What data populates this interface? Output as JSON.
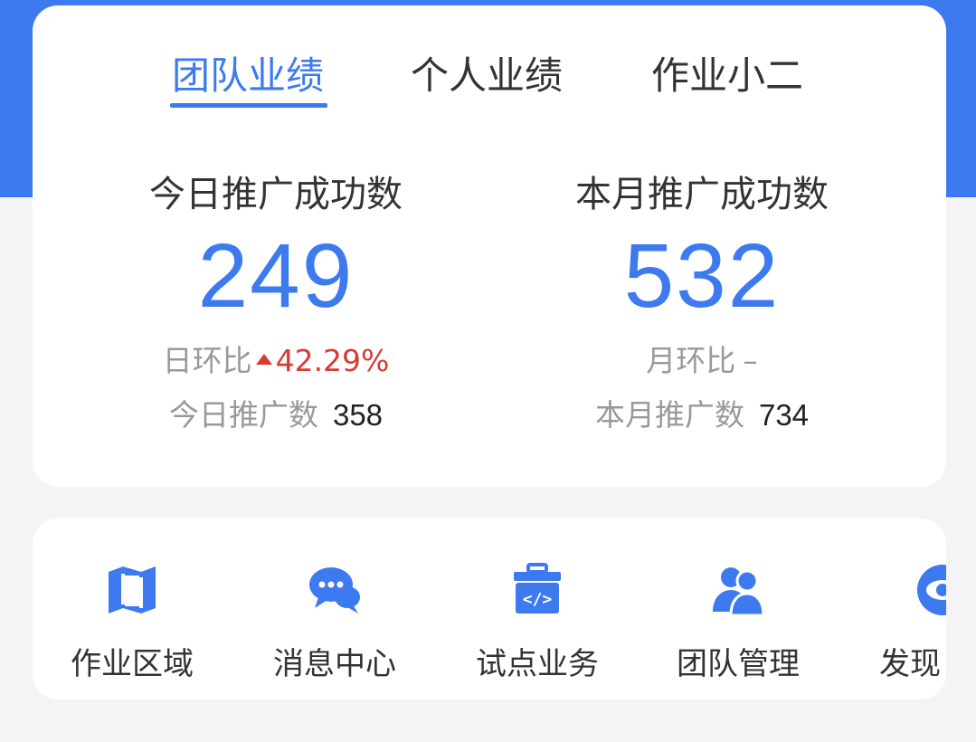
{
  "tabs": [
    {
      "label": "团队业绩",
      "active": true
    },
    {
      "label": "个人业绩",
      "active": false
    },
    {
      "label": "作业小二",
      "active": false
    }
  ],
  "today": {
    "title": "今日推广成功数",
    "value": "249",
    "ratio_label": "日环比",
    "ratio_value": "42.29%",
    "ratio_trend": "up",
    "count_label": "今日推广数",
    "count_value": "358"
  },
  "month": {
    "title": "本月推广成功数",
    "value": "532",
    "ratio_label": "月环比",
    "ratio_value": "–",
    "count_label": "本月推广数",
    "count_value": "734"
  },
  "shortcuts": [
    {
      "label": "作业区域",
      "icon": "book-icon"
    },
    {
      "label": "消息中心",
      "icon": "chat-bubble-icon"
    },
    {
      "label": "试点业务",
      "icon": "code-bag-icon"
    },
    {
      "label": "团队管理",
      "icon": "team-icon"
    },
    {
      "label": "发现",
      "icon": "eye-icon"
    }
  ],
  "colors": {
    "accent": "#3d7af0",
    "up": "#d63b35",
    "muted": "#999999"
  }
}
